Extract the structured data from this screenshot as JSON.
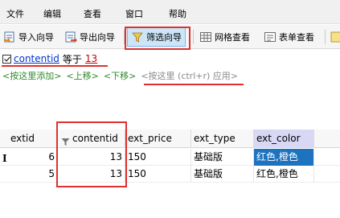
{
  "menubar": {
    "items": [
      "文件",
      "编辑",
      "查看",
      "窗口",
      "帮助"
    ]
  },
  "toolbar": {
    "buttons": [
      {
        "label": "导入向导",
        "icon": "import-wizard-icon"
      },
      {
        "label": "导出向导",
        "icon": "export-wizard-icon"
      },
      {
        "label": "筛选向导",
        "icon": "filter-funnel-icon",
        "active": true
      },
      {
        "label": "网格查看",
        "icon": "grid-view-icon"
      },
      {
        "label": "表单查看",
        "icon": "form-view-icon"
      }
    ]
  },
  "filter": {
    "condition": {
      "checked": true,
      "field": "contentid",
      "operator": "等于",
      "value": "13"
    },
    "actions": {
      "add": "<按这里添加>",
      "up": "<上移>",
      "down": "<下移>",
      "apply": "<按这里 (ctrl+r) 应用>"
    }
  },
  "grid": {
    "columns": [
      "extid",
      "contentid",
      "ext_price",
      "ext_type",
      "ext_color"
    ],
    "rows": [
      {
        "extid": "6",
        "contentid": "13",
        "ext_price": "150",
        "ext_type": "基础版",
        "ext_color": "红色,橙色",
        "current": true
      },
      {
        "extid": "5",
        "contentid": "13",
        "ext_price": "150",
        "ext_type": "基础版",
        "ext_color": "红色,橙色"
      }
    ],
    "row_indicator": "I"
  },
  "colors": {
    "accent_red": "#e03030",
    "selection_blue": "#1e73be",
    "link_blue": "#0033cc",
    "action_green": "#2e8b2e"
  }
}
